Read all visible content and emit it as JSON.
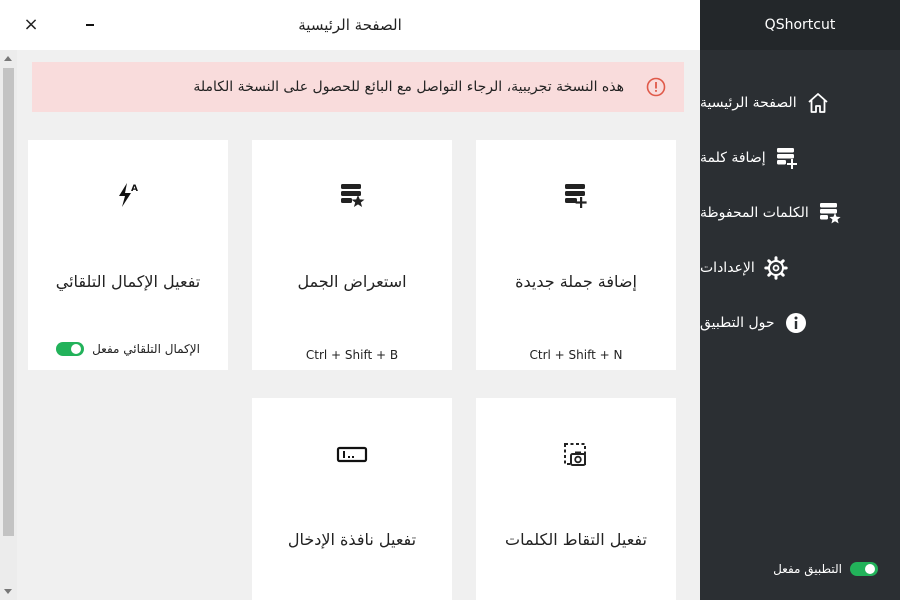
{
  "window": {
    "title": "الصفحة الرئيسية",
    "close_glyph": "×"
  },
  "sidebar": {
    "brand": "QShortcut",
    "items": [
      {
        "label": "الصفحة الرئيسية",
        "icon": "home-icon"
      },
      {
        "label": "إضافة كلمة",
        "icon": "add-list-icon"
      },
      {
        "label": "الكلمات المحفوظة",
        "icon": "starred-list-icon"
      },
      {
        "label": "الإعدادات",
        "icon": "gear-icon"
      },
      {
        "label": "حول التطبيق",
        "icon": "info-icon"
      }
    ],
    "app_status": {
      "label": "التطبيق مفعل",
      "enabled": true
    }
  },
  "banner": {
    "text": "هذه النسخة تجريبية، الرجاء التواصل مع البائع للحصول على النسخة الكاملة",
    "icon": "warning-circle-icon",
    "color": "#f9dcdc"
  },
  "cards": [
    {
      "title": "إضافة جملة جديدة",
      "shortcut": "Ctrl + Shift + N",
      "icon": "add-list-icon"
    },
    {
      "title": "استعراض الجمل",
      "shortcut": "Ctrl + Shift + B",
      "icon": "starred-list-icon"
    },
    {
      "title": "تفعيل الإكمال التلقائي",
      "toggle_label": "الإكمال التلقائي مفعل",
      "toggle_enabled": true,
      "icon": "flash-auto-icon"
    },
    {
      "title": "تفعيل التقاط الكلمات",
      "icon": "screen-capture-icon"
    },
    {
      "title": "تفعيل نافذة الإدخال",
      "icon": "input-box-icon"
    }
  ],
  "colors": {
    "sidebar_bg": "#2b2f33",
    "brand_bg": "#23272a",
    "toggle_on": "#22b25a",
    "warning_red": "#e05a4a"
  }
}
